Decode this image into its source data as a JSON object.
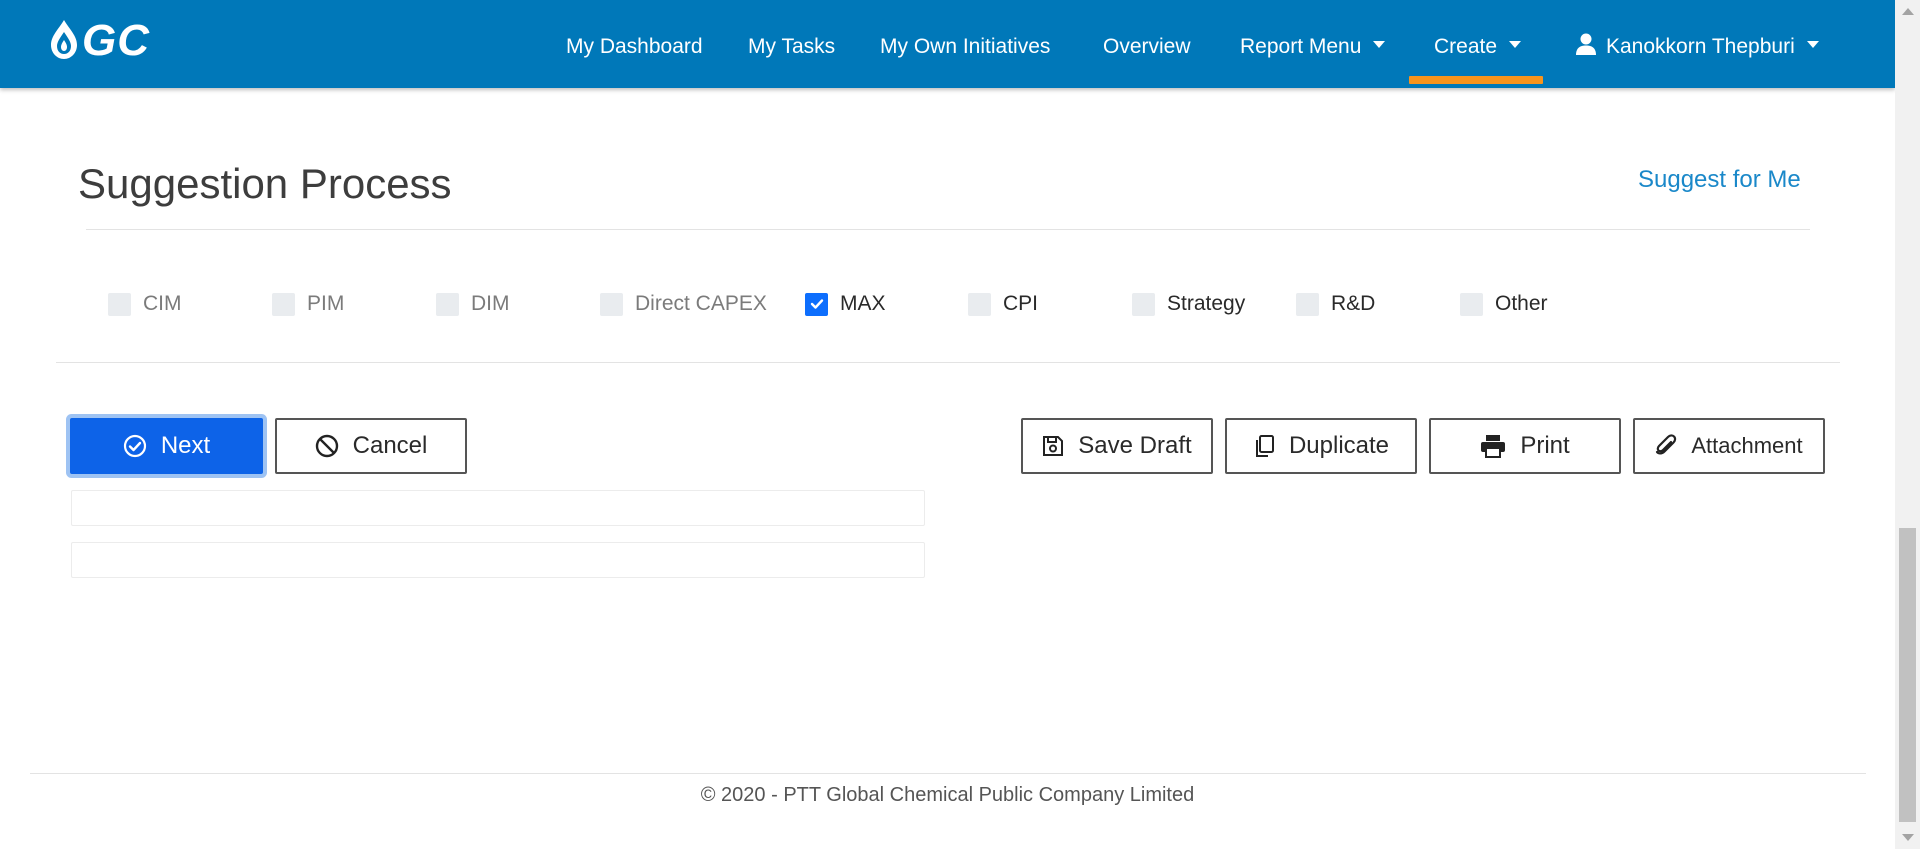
{
  "brand": {
    "logo_text": "GC",
    "nav_color": "#0078b9",
    "accent": "#f7941d"
  },
  "nav": {
    "dashboard": "My Dashboard",
    "tasks": "My Tasks",
    "initiatives": "My Own Initiatives",
    "overview": "Overview",
    "report_menu": "Report Menu",
    "create": "Create",
    "user": "Kanokkorn Thepburi"
  },
  "page": {
    "title": "Suggestion Process",
    "suggest_link": "Suggest for Me"
  },
  "processes": [
    {
      "label": "CIM",
      "checked": false,
      "enabled": false
    },
    {
      "label": "PIM",
      "checked": false,
      "enabled": false
    },
    {
      "label": "DIM",
      "checked": false,
      "enabled": false
    },
    {
      "label": "Direct CAPEX",
      "checked": false,
      "enabled": false
    },
    {
      "label": "MAX",
      "checked": true,
      "enabled": true
    },
    {
      "label": "CPI",
      "checked": false,
      "enabled": true
    },
    {
      "label": "Strategy",
      "checked": false,
      "enabled": true
    },
    {
      "label": "R&D",
      "checked": false,
      "enabled": true
    },
    {
      "label": "Other",
      "checked": false,
      "enabled": true
    }
  ],
  "actions": {
    "next": "Next",
    "cancel": "Cancel",
    "save_draft": "Save Draft",
    "duplicate": "Duplicate",
    "print": "Print",
    "attachment": "Attachment"
  },
  "footer": {
    "copyright": "© 2020 - PTT Global Chemical Public Company Limited"
  }
}
